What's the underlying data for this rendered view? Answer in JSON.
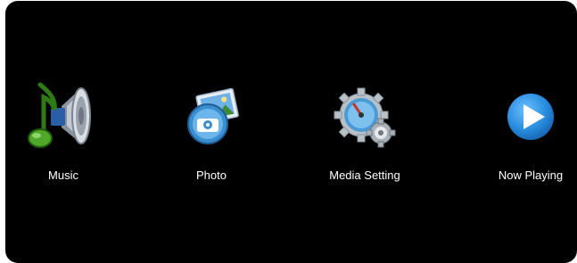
{
  "menu": {
    "items": [
      {
        "label": "Music",
        "icon": "music-speaker-icon"
      },
      {
        "label": "Photo",
        "icon": "photo-camera-icon"
      },
      {
        "label": "Media Setting",
        "icon": "media-setting-gear-icon"
      },
      {
        "label": "Now Playing",
        "icon": "play-button-icon"
      }
    ]
  },
  "colors": {
    "background": "#000000",
    "label_text": "#ffffff",
    "music_note": "#3a8c1e",
    "photo_blue": "#3a8fd0",
    "play_blue": "#2a8ee0"
  }
}
